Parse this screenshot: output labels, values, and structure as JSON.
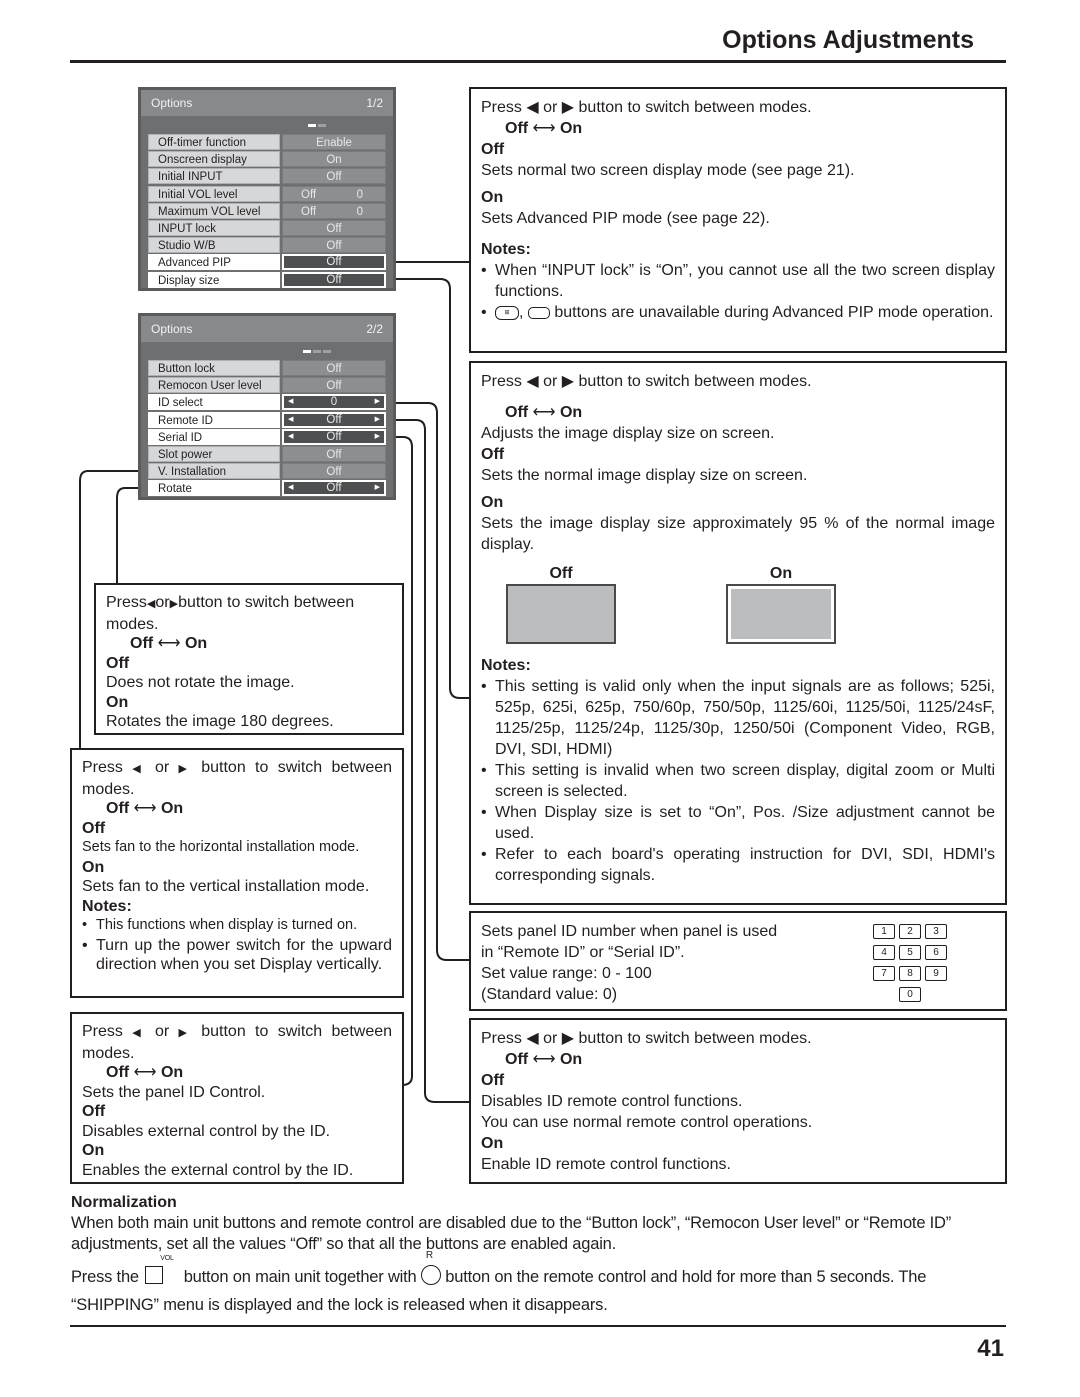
{
  "page": {
    "title": "Options Adjustments",
    "number": "41"
  },
  "menu1": {
    "title": "Options",
    "page": "1/2",
    "rows": [
      {
        "label": "Off-timer function",
        "value": "Enable"
      },
      {
        "label": "Onscreen display",
        "value": "On"
      },
      {
        "label": "Initial INPUT",
        "value": "Off"
      },
      {
        "label": "Initial VOL level",
        "value": "Off",
        "value2": "0"
      },
      {
        "label": "Maximum VOL level",
        "value": "Off",
        "value2": "0"
      },
      {
        "label": "INPUT lock",
        "value": "Off"
      },
      {
        "label": "Studio W/B",
        "value": "Off"
      },
      {
        "label": "Advanced PIP",
        "value": "Off"
      },
      {
        "label": "Display size",
        "value": "Off"
      }
    ]
  },
  "menu2": {
    "title": "Options",
    "page": "2/2",
    "rows": [
      {
        "label": "Button lock",
        "value": "Off"
      },
      {
        "label": "Remocon User level",
        "value": "Off"
      },
      {
        "label": "ID select",
        "value": "0"
      },
      {
        "label": "Remote ID",
        "value": "Off"
      },
      {
        "label": "Serial ID",
        "value": "Off"
      },
      {
        "label": "Slot power",
        "value": "Off"
      },
      {
        "label": "V. Installation",
        "value": "Off"
      },
      {
        "label": "Rotate",
        "value": "Off"
      }
    ]
  },
  "common": {
    "press_a": "Press ◀ or ▶ button to switch between modes.",
    "press_b": "Press",
    "press_c": "or",
    "press_d": "button to switch between",
    "modes": "modes.",
    "off": "Off",
    "on": "On",
    "toggle_arrow": "⟷",
    "notes": "Notes:",
    "bullet": "•"
  },
  "advanced_pip": {
    "off_desc": "Sets normal two screen display mode (see page 21).",
    "on_desc": "Sets Advanced PIP mode (see page 22).",
    "note1": "When “INPUT lock” is “On”, you cannot use all the two screen display functions.",
    "note2_icon1_label": "ASPECT",
    "note2_icon2_top": "MOVE",
    "note2_icon2_bottom": "ZOOM",
    "note2_text": "buttons are unavailable during Advanced PIP mode operation."
  },
  "display_size": {
    "intro": "Adjusts the image display size on screen.",
    "off_desc": "Sets the normal image display size on screen.",
    "on_desc": "Sets the image display size approximately 95 % of the normal image display.",
    "fig_off": "Off",
    "fig_on": "On",
    "notes": [
      "This setting is valid only when the input signals are as follows; 525i, 525p, 625i, 625p, 750/60p, 750/50p, 1125/60i, 1125/50i, 1125/24sF, 1125/25p, 1125/24p, 1125/30p, 1250/50i (Component Video, RGB, DVI, SDI, HDMI)",
      "This setting is invalid when two screen display, digital zoom or Multi screen is selected.",
      "When Display size is set to “On”, Pos. /Size adjustment cannot be used.",
      "Refer to each board's operating instruction for DVI, SDI, HDMI's corresponding signals."
    ]
  },
  "id_select": {
    "lines": [
      "Sets panel ID number when panel is used",
      "in “Remote ID” or “Serial ID”.",
      "Set value range: 0 - 100",
      "(Standard value: 0)"
    ],
    "keypad": [
      [
        "1",
        "2",
        "3"
      ],
      [
        "4",
        "5",
        "6"
      ],
      [
        "7",
        "8",
        "9"
      ],
      [
        "0"
      ]
    ]
  },
  "remote_id": {
    "off_desc1": "Disables ID remote control functions.",
    "off_desc2": "You can use normal remote control operations.",
    "on_desc": "Enable ID remote control functions."
  },
  "rotate": {
    "off_desc": "Does not rotate the image.",
    "on_desc": "Rotates the image 180 degrees."
  },
  "v_installation": {
    "off_desc": "Sets fan to the horizontal installation mode.",
    "on_desc": "Sets fan to the vertical installation mode.",
    "notes": [
      "This functions when display is turned on.",
      "Turn up the power switch for the upward direction when you set Display vertically."
    ]
  },
  "serial_id": {
    "intro": "Sets the panel ID Control.",
    "off_desc": "Disables external control by the ID.",
    "on_desc": "Enables the external control by the ID."
  },
  "normalization": {
    "heading": "Normalization",
    "para1": "When both main unit buttons and remote control are disabled due to the “Button lock”, “Remocon User level” or “Remote ID” adjustments, set all the values “Off” so that all the buttons are enabled again.",
    "para2_a": "Press the",
    "vol_label": "VOL",
    "para2_b": "button on main unit together with",
    "r_label": "R",
    "para2_c": "button on the remote control and hold for more than 5 seconds. The “SHIPPING” menu is displayed and the lock is released when it disappears."
  }
}
